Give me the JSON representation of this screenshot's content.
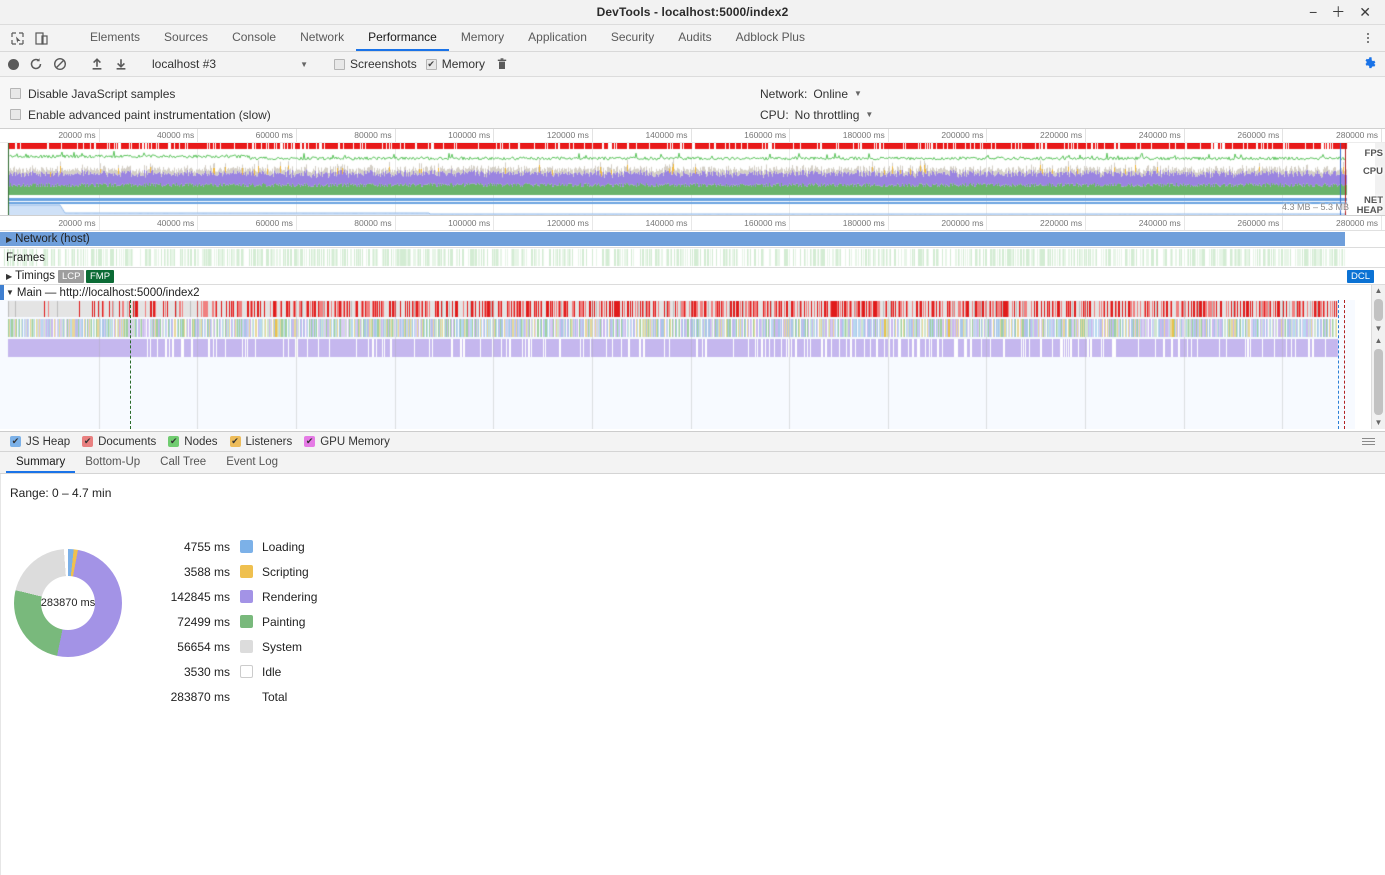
{
  "window": {
    "title": "DevTools - localhost:5000/index2",
    "minimize": "−",
    "maximize": "＋",
    "close": "✕"
  },
  "tabstrip": {
    "inspect_icon": "inspect-element-icon",
    "device_icon": "device-toolbar-icon",
    "tabs": [
      {
        "label": "Elements",
        "active": false
      },
      {
        "label": "Sources",
        "active": false
      },
      {
        "label": "Console",
        "active": false
      },
      {
        "label": "Network",
        "active": false
      },
      {
        "label": "Performance",
        "active": true
      },
      {
        "label": "Memory",
        "active": false
      },
      {
        "label": "Application",
        "active": false
      },
      {
        "label": "Security",
        "active": false
      },
      {
        "label": "Audits",
        "active": false
      },
      {
        "label": "Adblock Plus",
        "active": false
      }
    ],
    "more_icon": "kebab-menu-icon"
  },
  "record_toolbar": {
    "record_icon": "record-icon",
    "reload_icon": "reload-record-icon",
    "clear_icon": "clear-recording-icon",
    "upload_icon": "load-profile-icon",
    "download_icon": "save-profile-icon",
    "session": "localhost #3",
    "session_caret": "▼",
    "screenshots_label": "Screenshots",
    "screenshots_checked": false,
    "memory_label": "Memory",
    "memory_checked": true,
    "memory_check_glyph": "✔",
    "trash_icon": "delete-icon",
    "settings_icon": "gear-icon"
  },
  "settings": {
    "disable_js_samples": "Disable JavaScript samples",
    "disable_js_samples_checked": false,
    "enable_paint_instrumentation": "Enable advanced paint instrumentation (slow)",
    "enable_paint_instrumentation_checked": false,
    "network_label": "Network:",
    "network_value": "Online",
    "cpu_label": "CPU:",
    "cpu_value": "No throttling",
    "caret": "▼"
  },
  "overview": {
    "ticks": [
      "20000 ms",
      "40000 ms",
      "60000 ms",
      "80000 ms",
      "100000 ms",
      "120000 ms",
      "140000 ms",
      "160000 ms",
      "180000 ms",
      "200000 ms",
      "220000 ms",
      "240000 ms",
      "260000 ms",
      "280000 ms"
    ],
    "bands": [
      "FPS",
      "CPU",
      "NET",
      "HEAP"
    ],
    "heap_range": "4.3 MB – 5.3 MB",
    "colors": {
      "fps_line": "#5ec45e",
      "cpu_rendering": "#9a84e0",
      "cpu_painting": "#6ab36a",
      "cpu_scripting": "#efb840",
      "cpu_system": "#d4cfc6",
      "net": "#6aa3e0",
      "heap": "#cfe1f7",
      "frames_red": "#e81a1a"
    }
  },
  "tracks": {
    "ticks": [
      "20000 ms",
      "40000 ms",
      "60000 ms",
      "80000 ms",
      "100000 ms",
      "120000 ms",
      "140000 ms",
      "160000 ms",
      "180000 ms",
      "200000 ms",
      "220000 ms",
      "240000 ms",
      "260000 ms",
      "280000 ms"
    ],
    "network": {
      "label": "Network",
      "suffix": "(host)",
      "expander": "▶"
    },
    "frames": {
      "label": "Frames"
    },
    "timings": {
      "label": "Timings",
      "expander": "▶",
      "lcp": "LCP",
      "fmp": "FMP",
      "dcl": "DCL"
    },
    "main": {
      "expander": "▼",
      "label": "Main",
      "url": "— http://localhost:5000/index2"
    },
    "scroll_up": "▲",
    "scroll_down": "▼"
  },
  "memory_legend": {
    "items": [
      {
        "label": "JS Heap",
        "color": "#7cb1e8",
        "checked": true
      },
      {
        "label": "Documents",
        "color": "#e98080",
        "checked": true
      },
      {
        "label": "Nodes",
        "color": "#70cc70",
        "checked": true
      },
      {
        "label": "Listeners",
        "color": "#edbc5a",
        "checked": true
      },
      {
        "label": "GPU Memory",
        "color": "#e57ae5",
        "checked": true
      }
    ],
    "check_glyph": "✔",
    "menu_icon": "hamburger-menu-icon"
  },
  "bottom_tabs": [
    {
      "label": "Summary",
      "active": true
    },
    {
      "label": "Bottom-Up",
      "active": false
    },
    {
      "label": "Call Tree",
      "active": false
    },
    {
      "label": "Event Log",
      "active": false
    }
  ],
  "summary": {
    "range": "Range: 0 – 4.7 min",
    "donut_center": "283870 ms",
    "total_value": "283870 ms",
    "total_label": "Total"
  },
  "chart_data": {
    "type": "pie",
    "title": "Activity breakdown",
    "center_label": "283870 ms",
    "unit": "ms",
    "categories": [
      "Loading",
      "Scripting",
      "Rendering",
      "Painting",
      "System",
      "Idle"
    ],
    "values": [
      4755,
      3588,
      142845,
      72499,
      56654,
      3530
    ],
    "value_labels": [
      "4755 ms",
      "3588 ms",
      "142845 ms",
      "72499 ms",
      "56654 ms",
      "3530 ms"
    ],
    "colors": [
      "#7cb1e8",
      "#efc04f",
      "#a393e6",
      "#79b97c",
      "#dcdcdc",
      "#ffffff"
    ],
    "total": 283870,
    "total_label": "283870 ms",
    "legend_position": "right",
    "donut": true
  }
}
